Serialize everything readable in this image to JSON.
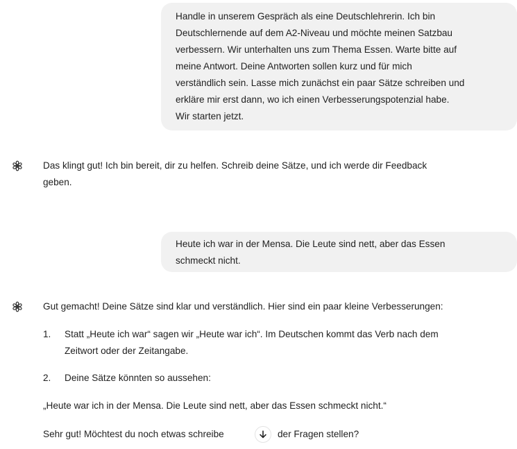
{
  "conversation": {
    "user_message_1": {
      "lines": [
        "Handle in unserem Gespräch als eine Deutschlehrerin. Ich bin",
        "Deutschlernende auf dem A2-Niveau und möchte meinen Satzbau",
        "verbessern. Wir unterhalten uns zum Thema Essen. Warte bitte auf",
        "meine Antwort. Deine Antworten sollen kurz und für mich",
        "verständlich sein. Lasse mich zunächst ein paar Sätze schreiben und",
        "erkläre mir erst dann, wo ich einen Verbesserungspotenzial habe.",
        "Wir starten jetzt."
      ]
    },
    "assistant_message_1": {
      "lines": [
        "Das klingt gut! Ich bin bereit, dir zu helfen. Schreib deine Sätze, und ich werde dir Feedback",
        "geben."
      ]
    },
    "user_message_2": {
      "lines": [
        "Heute ich war in der Mensa. Die Leute sind nett, aber das Essen",
        "schmeckt nicht."
      ]
    },
    "assistant_message_2": {
      "intro": "Gut gemacht! Deine Sätze sind klar und verständlich. Hier sind ein paar kleine Verbesserungen:",
      "list": [
        {
          "number": "1.",
          "lines": [
            "Statt „Heute ich war“ sagen wir „Heute war ich“. Im Deutschen kommt das Verb nach dem",
            "Zeitwort oder der Zeitangabe."
          ]
        },
        {
          "number": "2.",
          "lines": [
            "Deine Sätze könnten so aussehen:"
          ]
        }
      ],
      "corrected": "„Heute war ich in der Mensa. Die Leute sind nett, aber das Essen schmeckt nicht.“",
      "closing_before": "Sehr gut! Möchtest du noch etwas schreibe",
      "closing_after": "der Fragen stellen?"
    }
  },
  "icons": {
    "assistant_avatar": "openai-logo-icon",
    "scroll_down": "arrow-down-icon"
  },
  "colors": {
    "user_bubble": "#f1f1f1",
    "text": "#1f1f1f",
    "background": "#ffffff"
  }
}
